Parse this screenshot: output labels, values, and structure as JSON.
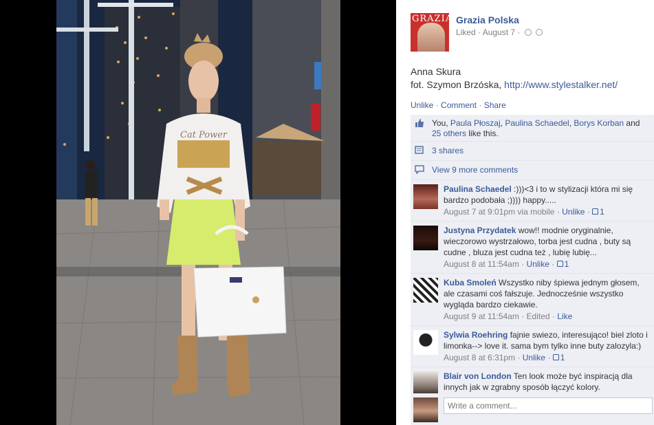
{
  "post": {
    "page_name": "Grazia Polska",
    "meta_liked": "Liked",
    "meta_sep": " · ",
    "meta_date": "August 7",
    "avatar_title": "GRAZIA",
    "body_line1": "Anna Skura",
    "body_line2_prefix": "fot. Szymon Brzóska, ",
    "body_link": "http://www.stylestalker.net/"
  },
  "actions": {
    "unlike": "Unlike",
    "comment": "Comment",
    "share": "Share",
    "sep": " · "
  },
  "likes": {
    "you": "You, ",
    "names": [
      "Paula Płoszaj",
      "Paulina Schaedel",
      "Borys Korban"
    ],
    "comma": ", ",
    "and": " and ",
    "others": "25 others",
    "tail": " like this."
  },
  "shares": {
    "label": "3 shares"
  },
  "more_comments": {
    "label": "View 9 more comments"
  },
  "comments": [
    {
      "author": "Paulina Schaedel",
      "text": " :)))<3 i to w stylizacji która mi się bardzo podobała ;)))) happy.....",
      "time": "August 7 at 9:01pm via mobile",
      "action": "Unlike",
      "likes": "1"
    },
    {
      "author": "Justyna Przydatek",
      "text": " wow!! modnie oryginalnie, wieczorowo wystrzałowo, torba jest cudna , buty są cudne , bluza jest cudna też , lubię lubię...",
      "time": "August 8 at 11:54am",
      "action": "Unlike",
      "likes": "1"
    },
    {
      "author": "Kuba Smoleń",
      "text": " Wszystko niby śpiewa jednym głosem, ale czasami coś fałszuje. Jednocześnie wszystko wygląda bardzo ciekawie.",
      "time": "August 9 at 11:54am",
      "action": "Edited",
      "extra": "Like"
    },
    {
      "author": "Sylwia Roehring",
      "text": " fajnie swiezo, interesująco! biel zloto i limonka--> love it. sama bym tylko inne buty zalozyla:)",
      "time": "August 8 at 6:31pm",
      "action": "Unlike",
      "likes": "1"
    },
    {
      "author": "Blair von London",
      "text": " Ten look może być inspiracją dla innych jak w zgrabny sposób łączyć kolory."
    }
  ],
  "composer": {
    "placeholder": "Write a comment..."
  },
  "photo_text": {
    "shirt_print": "Cat Power"
  }
}
